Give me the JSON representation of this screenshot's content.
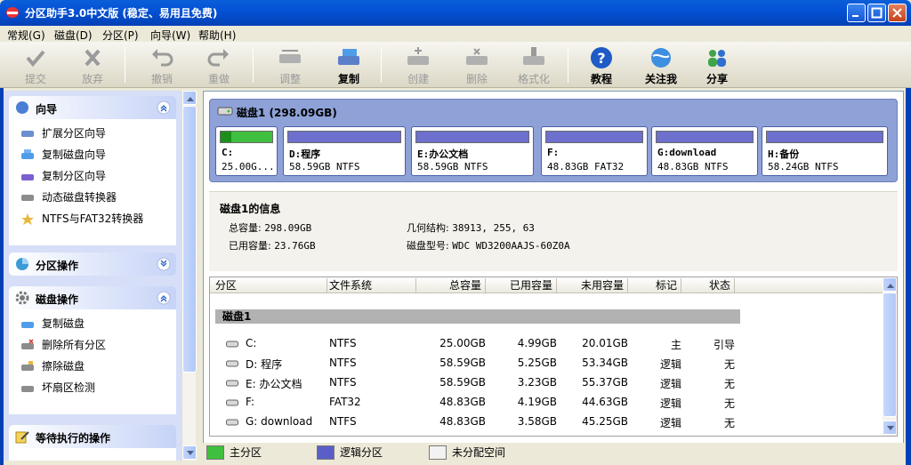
{
  "window": {
    "title": "分区助手3.0中文版 (稳定、易用且免费)"
  },
  "menu": [
    "常规(G)",
    "磁盘(D)",
    "分区(P)",
    "向导(W)",
    "帮助(H)"
  ],
  "toolbar": {
    "submit": "提交",
    "discard": "放弃",
    "undo": "撤销",
    "redo": "重做",
    "resize": "调整",
    "copy": "复制",
    "create": "创建",
    "delete": "删除",
    "format": "格式化",
    "tutorial": "教程",
    "follow": "关注我",
    "share": "分享"
  },
  "left": {
    "wizard": {
      "title": "向导",
      "items": [
        "扩展分区向导",
        "复制磁盘向导",
        "复制分区向导",
        "动态磁盘转换器",
        "NTFS与FAT32转换器"
      ]
    },
    "partition_ops": {
      "title": "分区操作"
    },
    "disk_ops": {
      "title": "磁盘操作",
      "items": [
        "复制磁盘",
        "删除所有分区",
        "擦除磁盘",
        "坏扇区检测"
      ]
    },
    "pending": {
      "title": "等待执行的操作"
    }
  },
  "disk": {
    "title": "磁盘1 (298.09GB)",
    "partitions": [
      {
        "name": "C:",
        "size": "25.00G...",
        "used_fraction": 0.2,
        "type": "primary"
      },
      {
        "name": "D:程序",
        "size": "58.59GB NTFS",
        "used_fraction": 0.09,
        "type": "logical"
      },
      {
        "name": "E:办公文档",
        "size": "58.59GB NTFS",
        "used_fraction": 0.06,
        "type": "logical"
      },
      {
        "name": "F:",
        "size": "48.83GB FAT32",
        "used_fraction": 0.09,
        "type": "logical"
      },
      {
        "name": "G:download",
        "size": "48.83GB NTFS",
        "used_fraction": 0.07,
        "type": "logical"
      },
      {
        "name": "H:备份",
        "size": "58.24GB NTFS",
        "used_fraction": 0.05,
        "type": "logical"
      }
    ]
  },
  "info": {
    "title": "磁盘1的信息",
    "total_label": "总容量:",
    "total": "298.09GB",
    "used_label": "已用容量:",
    "used": "23.76GB",
    "geometry_label": "几何结构:",
    "geometry": "38913, 255, 63",
    "model_label": "磁盘型号:",
    "model": "WDC WD3200AAJS-60Z0A"
  },
  "table": {
    "headers": [
      "分区",
      "文件系统",
      "总容量",
      "已用容量",
      "未用容量",
      "标记",
      "状态"
    ],
    "group": "磁盘1",
    "rows": [
      [
        "C:",
        "NTFS",
        "25.00GB",
        "4.99GB",
        "20.01GB",
        "主",
        "引导"
      ],
      [
        "D: 程序",
        "NTFS",
        "58.59GB",
        "5.25GB",
        "53.34GB",
        "逻辑",
        "无"
      ],
      [
        "E: 办公文档",
        "NTFS",
        "58.59GB",
        "3.23GB",
        "55.37GB",
        "逻辑",
        "无"
      ],
      [
        "F:",
        "FAT32",
        "48.83GB",
        "4.19GB",
        "44.63GB",
        "逻辑",
        "无"
      ],
      [
        "G: download",
        "NTFS",
        "48.83GB",
        "3.58GB",
        "45.25GB",
        "逻辑",
        "无"
      ]
    ]
  },
  "legend": {
    "primary": "主分区",
    "logical": "逻辑分区",
    "unallocated": "未分配空间"
  },
  "colors": {
    "primary": "#3fbf3f",
    "logical": "#5a5fc8",
    "unallocated": "#f2f2f2",
    "title_bar": "#0452d6"
  }
}
